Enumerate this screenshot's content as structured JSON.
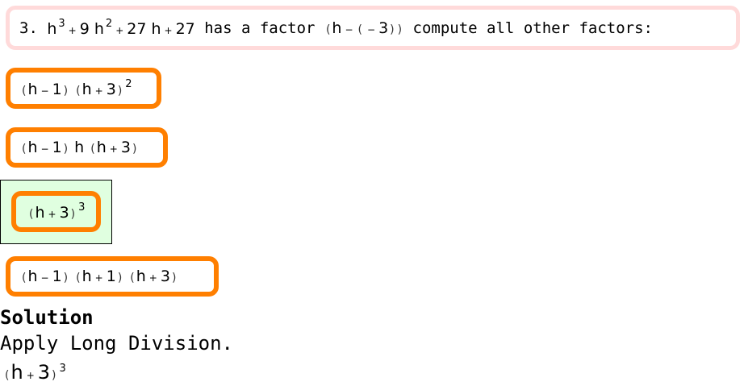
{
  "question": {
    "number": "3.",
    "expression": [
      {
        "t": "h"
      },
      {
        "s": "3"
      },
      {
        "o": "+"
      },
      {
        "t": "9 h"
      },
      {
        "s": "2"
      },
      {
        "o": "+"
      },
      {
        "t": "27 h"
      },
      {
        "o": "+"
      },
      {
        "t": "27"
      }
    ],
    "text_mid": "has a factor",
    "factor": [
      {
        "p": "("
      },
      {
        "t": "h"
      },
      {
        "o": "−"
      },
      {
        "p": "("
      },
      {
        "o": "−"
      },
      {
        "t": "3"
      },
      {
        "p": ")"
      },
      {
        "p": ")"
      }
    ],
    "text_end": "compute all other factors:"
  },
  "options": [
    {
      "math": [
        {
          "p": "("
        },
        {
          "t": "h"
        },
        {
          "o": "−"
        },
        {
          "t": "1"
        },
        {
          "p": ")"
        },
        {
          "sp": 1
        },
        {
          "p": "("
        },
        {
          "t": "h"
        },
        {
          "o": "+"
        },
        {
          "t": "3"
        },
        {
          "p": ")"
        },
        {
          "s": "2"
        }
      ],
      "selected": false
    },
    {
      "math": [
        {
          "p": "("
        },
        {
          "t": "h"
        },
        {
          "o": "−"
        },
        {
          "t": "1"
        },
        {
          "p": ")"
        },
        {
          "t": " h "
        },
        {
          "p": "("
        },
        {
          "t": "h"
        },
        {
          "o": "+"
        },
        {
          "t": "3"
        },
        {
          "p": ")"
        }
      ],
      "selected": false
    },
    {
      "math": [
        {
          "p": "("
        },
        {
          "t": "h"
        },
        {
          "o": "+"
        },
        {
          "t": "3"
        },
        {
          "p": ")"
        },
        {
          "s": "3"
        }
      ],
      "selected": true
    },
    {
      "math": [
        {
          "p": "("
        },
        {
          "t": "h"
        },
        {
          "o": "−"
        },
        {
          "t": "1"
        },
        {
          "p": ")"
        },
        {
          "sp": 1
        },
        {
          "p": "("
        },
        {
          "t": "h"
        },
        {
          "o": "+"
        },
        {
          "t": "1"
        },
        {
          "p": ")"
        },
        {
          "sp": 1
        },
        {
          "p": "("
        },
        {
          "t": "h"
        },
        {
          "o": "+"
        },
        {
          "t": "3"
        },
        {
          "p": ")"
        }
      ],
      "selected": false
    }
  ],
  "solution": {
    "heading": "Solution",
    "method": "Apply Long Division.",
    "answer": [
      {
        "p": "("
      },
      {
        "t": "h"
      },
      {
        "o": "+"
      },
      {
        "t": "3"
      },
      {
        "p": ")"
      },
      {
        "s": "3"
      }
    ]
  },
  "colors": {
    "option_border": "#ff7f00",
    "question_border": "#ffdada",
    "selected_bg": "#e0ffe0"
  }
}
